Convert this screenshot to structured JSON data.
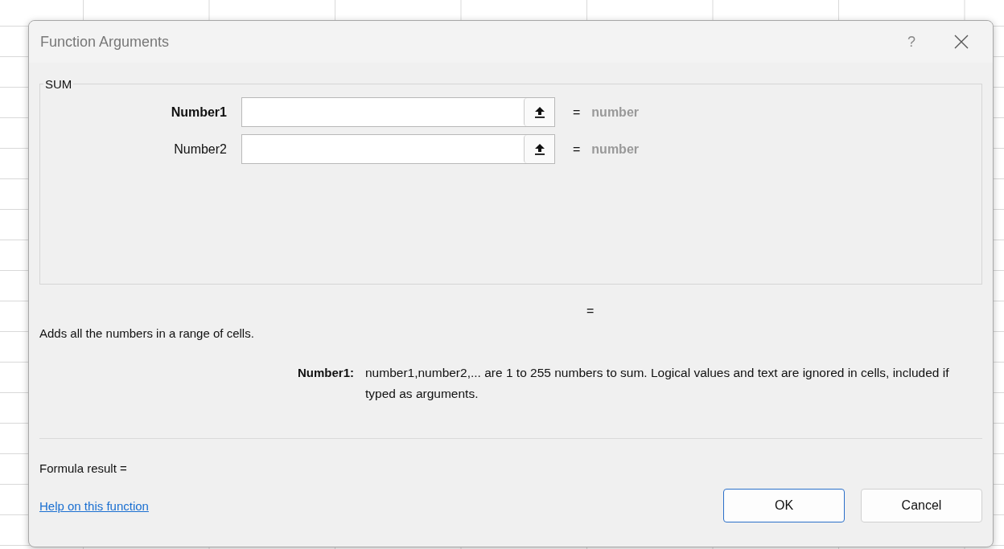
{
  "window": {
    "title": "Function Arguments",
    "help": "?"
  },
  "function_group": {
    "name": "SUM",
    "arguments": [
      {
        "label": "Number1",
        "required": true,
        "equals": "=",
        "result": "number"
      },
      {
        "label": "Number2",
        "required": false,
        "equals": "=",
        "result": "number"
      }
    ]
  },
  "function_result": "=",
  "description": "Adds all the numbers in a range of cells.",
  "argument_help": {
    "label": "Number1:",
    "text": "number1,number2,... are 1 to 255 numbers to sum. Logical values and text are ignored in cells, included if typed as arguments."
  },
  "formula_result": "Formula result =",
  "help_link": "Help on this function",
  "buttons": [
    {
      "label": "OK",
      "default": true
    },
    {
      "label": "Cancel",
      "default": false
    }
  ]
}
